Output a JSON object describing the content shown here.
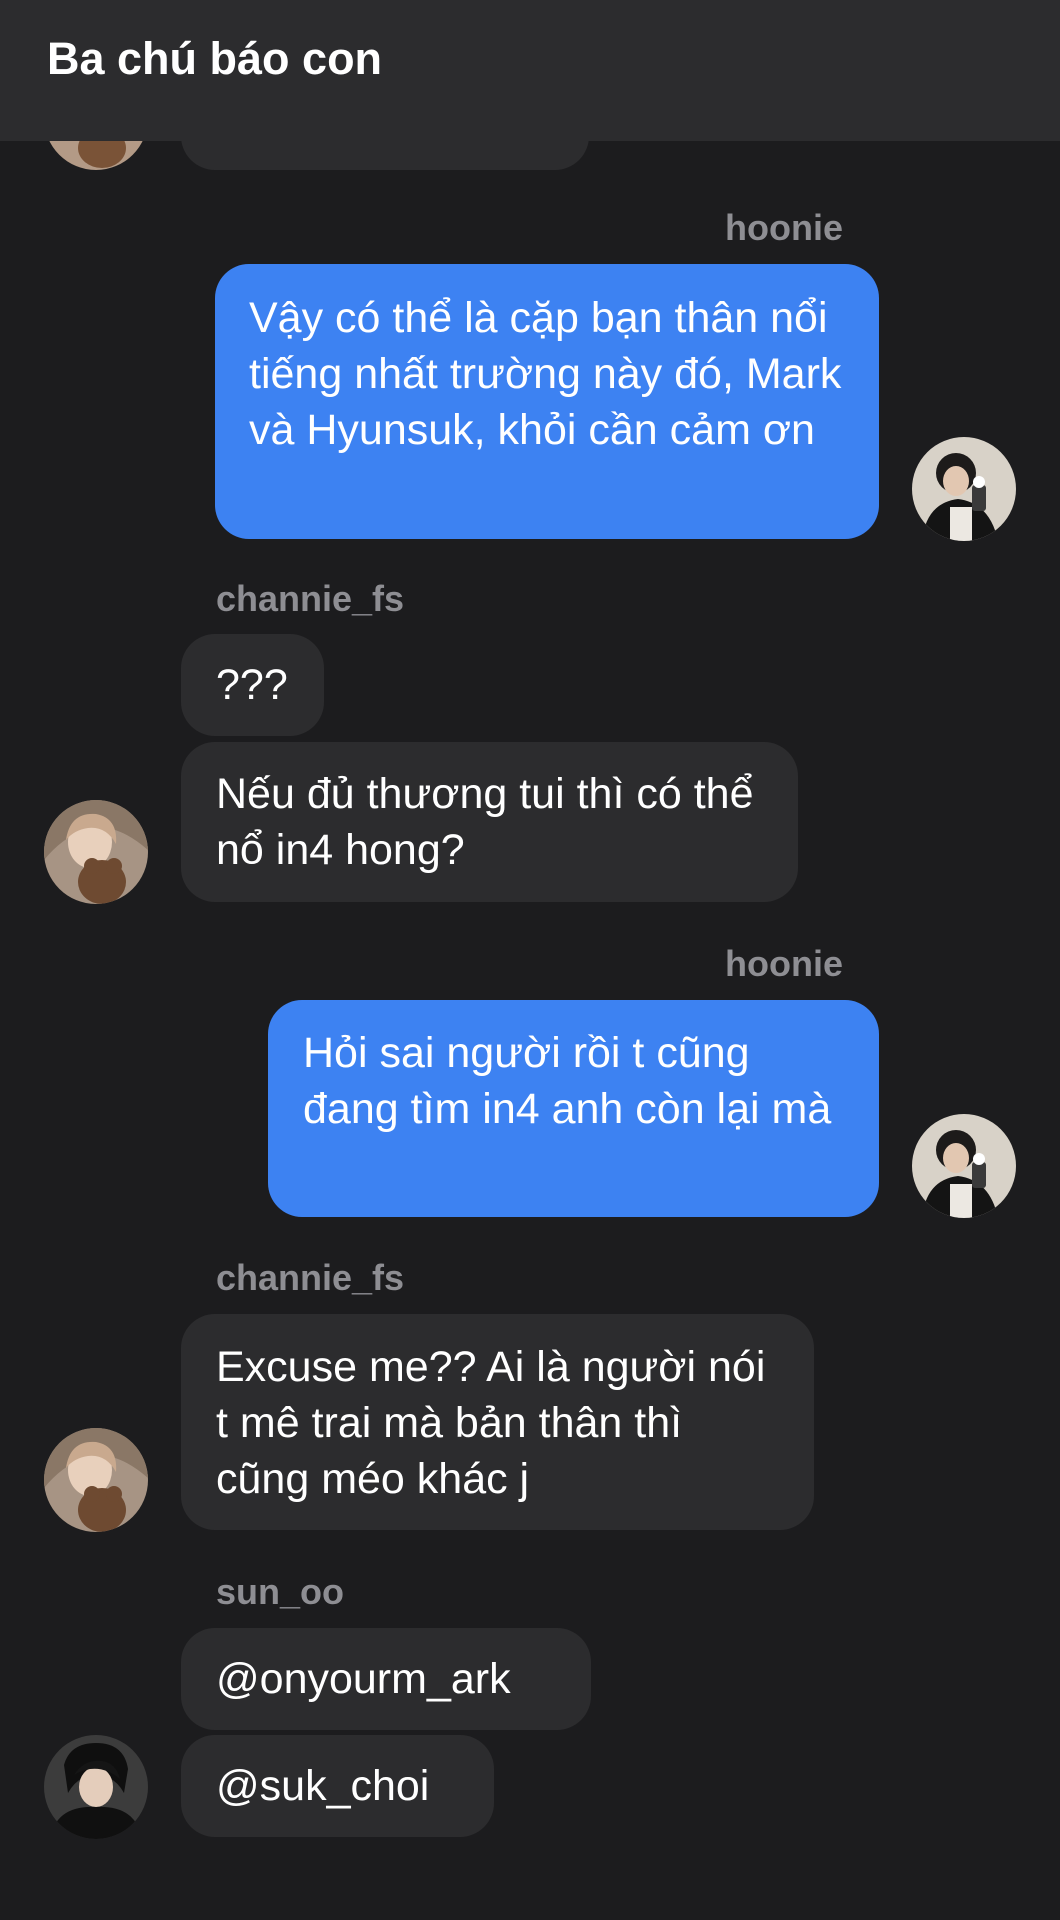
{
  "header": {
    "title": "Ba chú báo con"
  },
  "messages": [
    {
      "sender": "hoonie",
      "text": "Vậy có thể là cặp bạn thân nổi tiếng nhất trường này đó, Mark và Hyunsuk, khỏi cần cảm ơn"
    },
    {
      "sender": "channie_fs",
      "texts": [
        "???",
        "Nếu đủ thương tui thì có thể nổ in4 hong?"
      ]
    },
    {
      "sender": "hoonie",
      "text": "Hỏi sai người rồi t cũng đang tìm in4 anh còn lại mà"
    },
    {
      "sender": "channie_fs",
      "text": "Excuse me?? Ai là người nói t mê trai mà bản thân thì cũng méo khác j"
    },
    {
      "sender": "sun_oo",
      "texts": [
        "@onyourm_ark",
        "@suk_choi"
      ]
    }
  ],
  "colors": {
    "background": "#1c1c1e",
    "header": "#2c2c2e",
    "incoming_bubble": "#2c2c2e",
    "outgoing_bubble": "#3d82f2",
    "username": "#8e8e93"
  }
}
